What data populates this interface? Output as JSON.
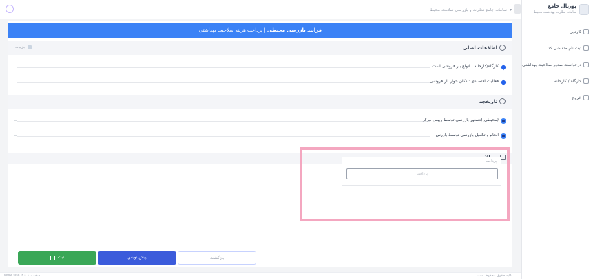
{
  "topbar": {
    "dropdown_text": "سامانه جامع نظارت و بازرسی سلامت محیط"
  },
  "sidebar": {
    "title": "پورتال جامع",
    "subtitle": "سامانه نظارت بهداشت محیط",
    "items": [
      {
        "label": "کارتابل"
      },
      {
        "label": "ثبت نام متقاضی کد"
      },
      {
        "label": "درخواست صدور صلاحیت بهداشتی"
      },
      {
        "label": "کارگاه / کارخانه"
      },
      {
        "label": "خروج"
      }
    ]
  },
  "banner": {
    "bold_text": "فرایند بازرسی محیطی",
    "rest_text": " | پرداخت هزینه صلاحیت بهداشتی"
  },
  "sections": {
    "basic_info": {
      "title": "اطلاعات اصلی",
      "meta": "جزئیات",
      "rows": [
        {
          "label": "کارگاه/کارخانه : انواع بار فروشی است",
          "end": "—"
        },
        {
          "label": "فعالیت اقتصادی : دکان خوار بار فروشی",
          "end": "—"
        }
      ]
    },
    "history": {
      "title": "تاریخچه",
      "rows": [
        {
          "label": "(محیطی)(دستور بازرسی توسط رییس مرکز",
          "end": "—"
        },
        {
          "label": "انجام و تکمیل بازرسی توسط بازرس",
          "end": "—"
        }
      ]
    },
    "questions": {
      "title": "سوالات",
      "answer_label": "پرداخت",
      "answer_placeholder": "پرداخت"
    }
  },
  "buttons": {
    "back": "بازگشت",
    "draft": "پیش نویس",
    "submit": "ثبت"
  },
  "footer": {
    "left": "www.site.ir • نسخه ۱.۰",
    "right": "کلیه حقوق محفوظ است"
  }
}
